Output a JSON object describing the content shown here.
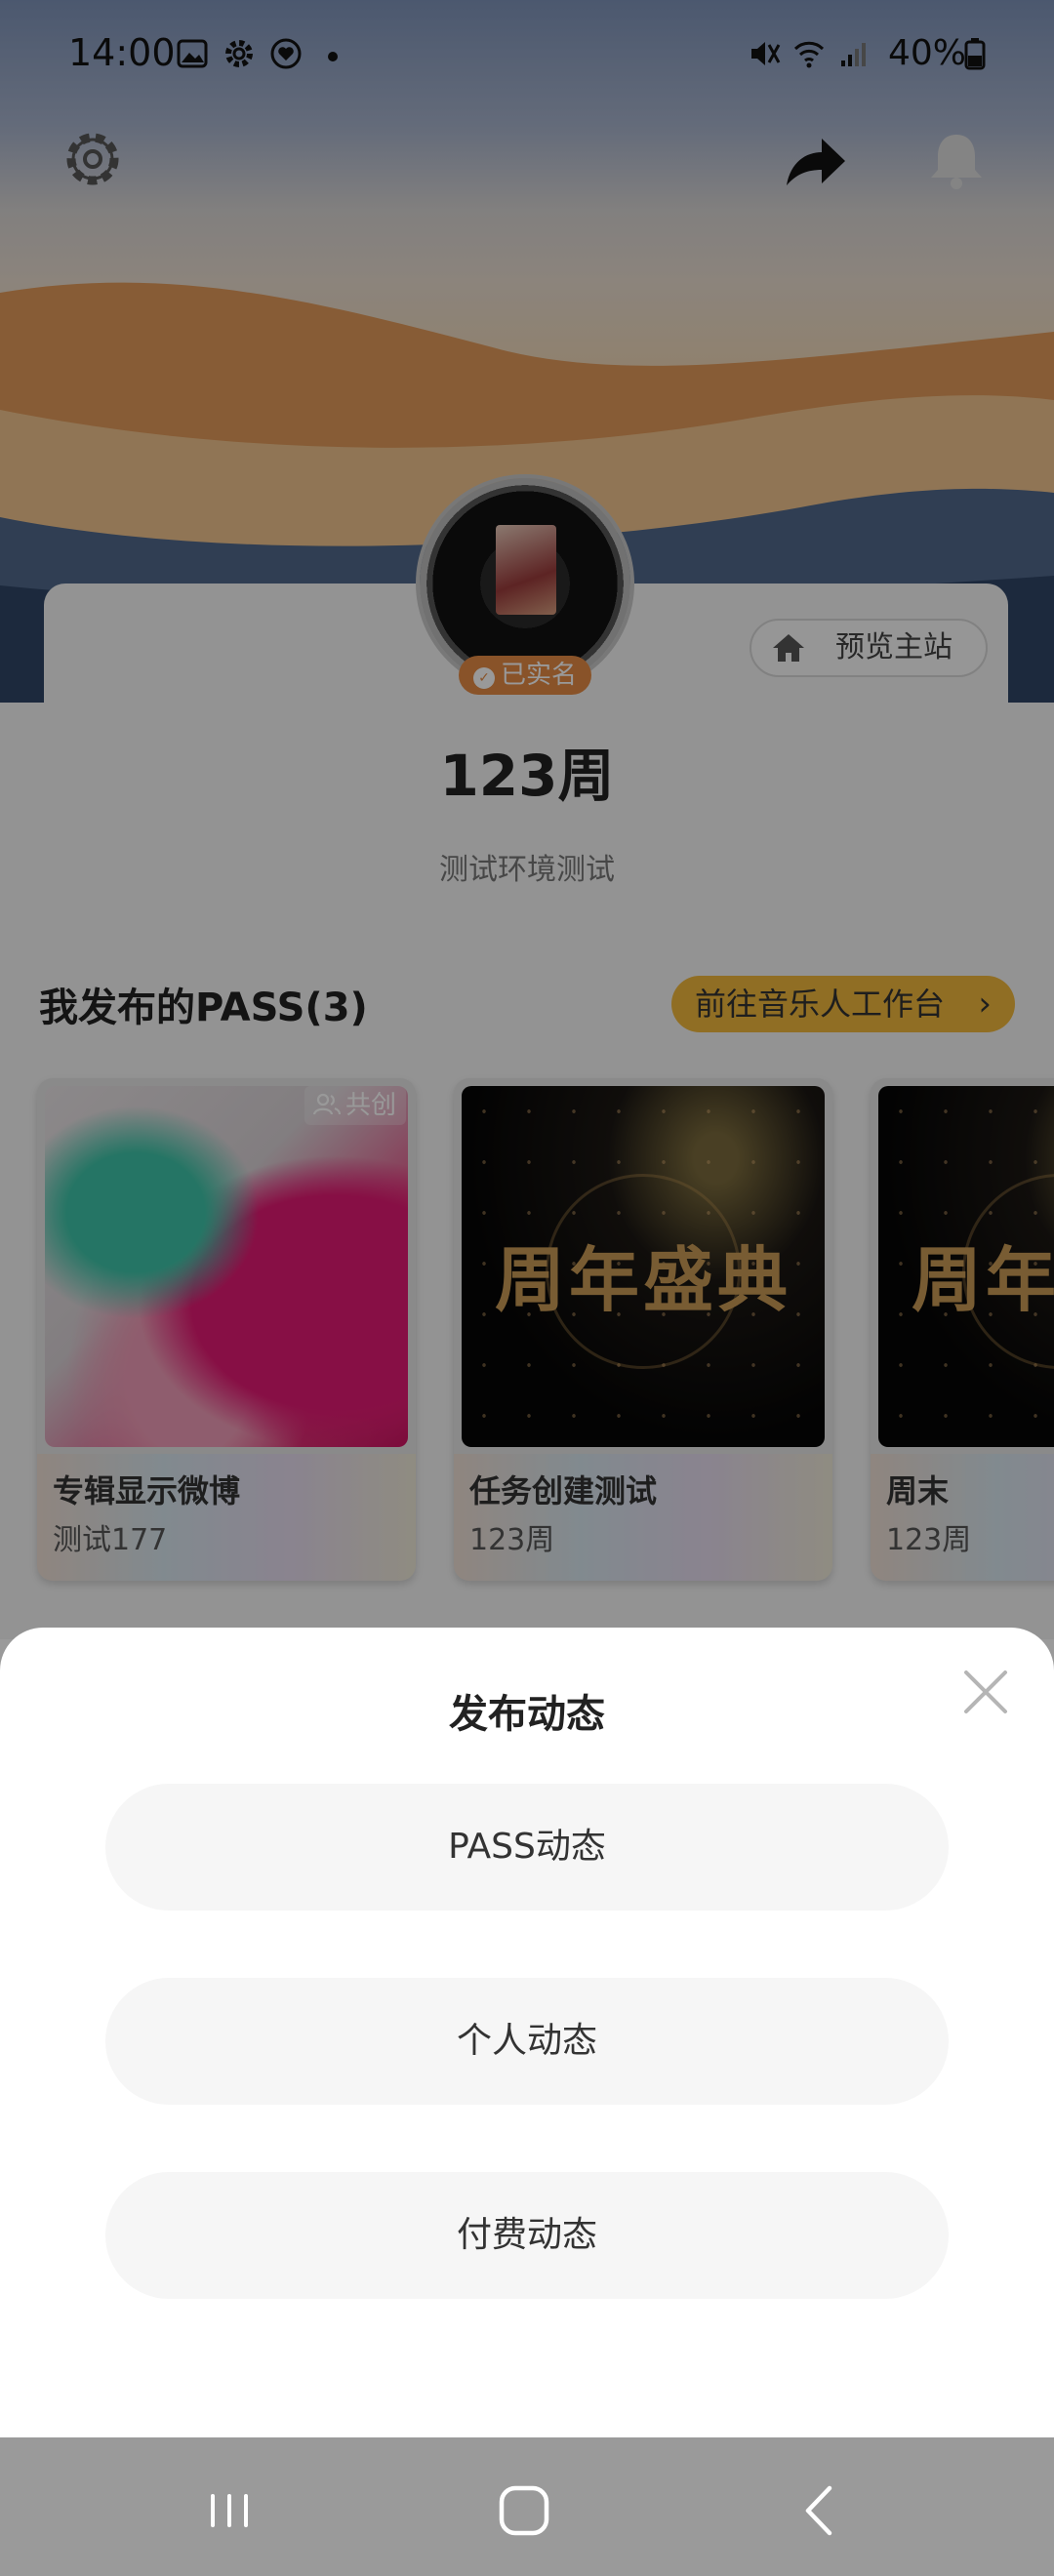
{
  "status_bar": {
    "time": "14:00",
    "battery": "40%",
    "left_icons": [
      "image-icon",
      "gear-icon",
      "heart-badge-icon"
    ],
    "right_icons": [
      "mute-icon",
      "wifi-icon",
      "signal-icon",
      "battery-icon"
    ]
  },
  "header": {
    "settings_icon": "gear-icon",
    "share_icon": "share-arrow-icon",
    "bell_icon": "bell-icon"
  },
  "profile": {
    "verified_badge": "已实名",
    "preview_label": "预览主站",
    "username": "123周",
    "bio": "测试环境测试"
  },
  "pass_section": {
    "title": "我发布的PASS(3)",
    "studio_button": "前往音乐人工作台",
    "cards": [
      {
        "title": "专辑显示微博",
        "author": "测试177",
        "badge": "共创"
      },
      {
        "title": "任务创建测试",
        "author": "123周",
        "art_text": "周年盛典"
      },
      {
        "title": "周末",
        "author": "123周",
        "art_text": "周年盛典"
      }
    ]
  },
  "sheet": {
    "title": "发布动态",
    "options": [
      "PASS动态",
      "个人动态",
      "付费动态"
    ]
  },
  "colors": {
    "accent_orange": "#e58b45",
    "studio_yellow": "#f1b73d",
    "overlay": "rgba(0,0,0,0.4)"
  }
}
